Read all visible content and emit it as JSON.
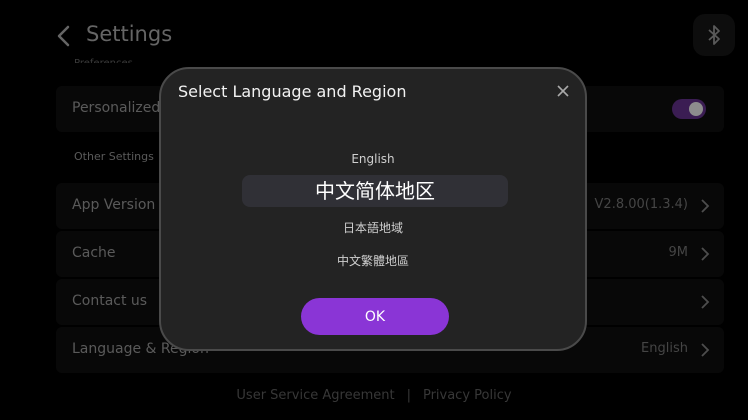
{
  "header": {
    "title": "Settings"
  },
  "settings": {
    "preferences_label": "Preferences",
    "personalized_label": "Personalized",
    "other_settings_label": "Other Settings",
    "rows": [
      {
        "label": "App Version",
        "value": "V2.8.00(1.3.4)"
      },
      {
        "label": "Cache",
        "value": "9M"
      },
      {
        "label": "Contact us",
        "value": ""
      },
      {
        "label": "Language & Region",
        "value": "English"
      }
    ]
  },
  "footer": {
    "user_agreement": "User Service Agreement",
    "separator": "|",
    "privacy_policy": "Privacy Policy"
  },
  "modal": {
    "title": "Select Language and Region",
    "options": [
      "English",
      "中文简体地区",
      "日本語地域",
      "中文繁體地區"
    ],
    "selected": "中文简体地区",
    "ok_label": "OK"
  },
  "colors": {
    "accent": "#8a35d6",
    "modal_bg": "#232323",
    "background": "#000000"
  }
}
